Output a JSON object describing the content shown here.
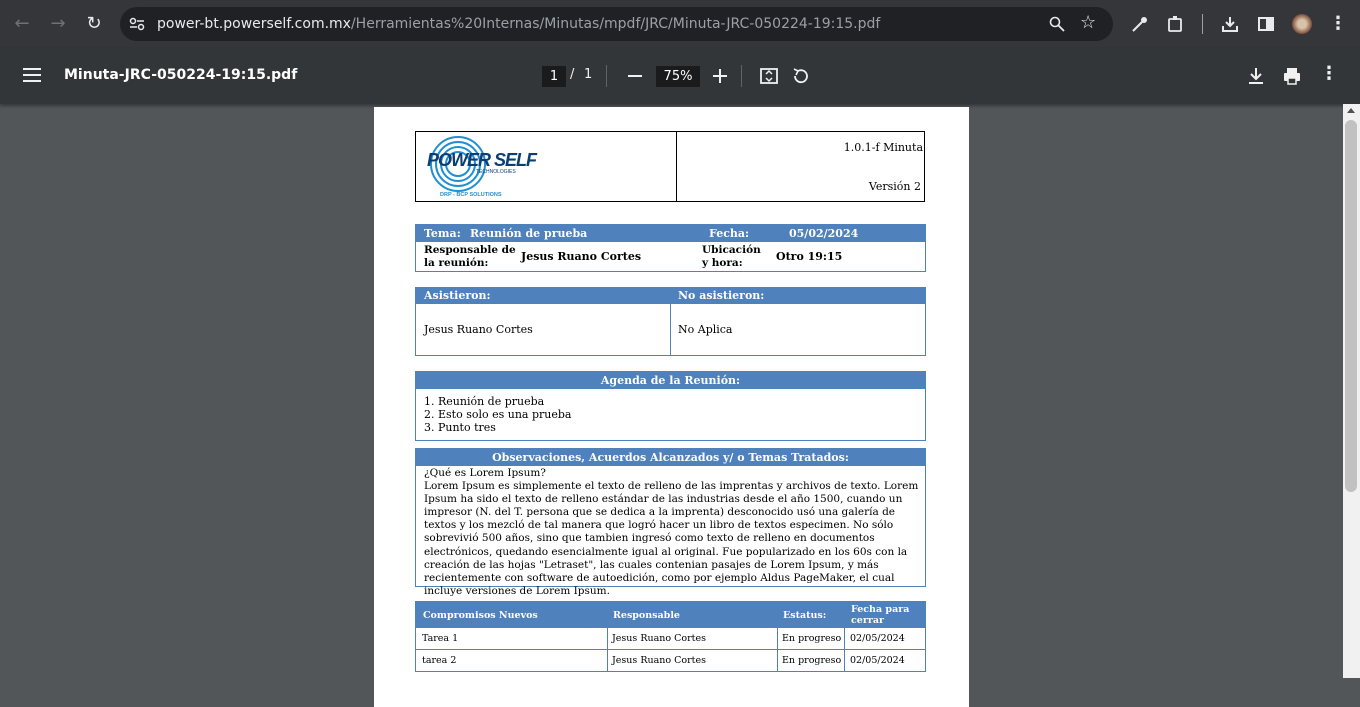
{
  "browser": {
    "url_host": "power-bt.powerself.com.mx",
    "url_path": "/Herramientas%20Internas/Minutas/mpdf/JRC/Minuta-JRC-050224-19:15.pdf"
  },
  "viewer": {
    "filename": "Minuta-JRC-050224-19:15.pdf",
    "page_current": "1",
    "page_sep": "/",
    "page_total": "1",
    "zoom": "75%"
  },
  "doc": {
    "logo": {
      "text": "POWER SELF",
      "sub": "TECHNOLOGIES",
      "tag": "DRP - BCP SOLUTIONS"
    },
    "code": "1.0.1-f Minuta",
    "version": "Versión 2",
    "info": {
      "tema_label": "Tema:",
      "tema": "Reunión de prueba",
      "fecha_label": "Fecha:",
      "fecha": "05/02/2024",
      "resp_label1": "Responsable de",
      "resp_label2": "la reunión:",
      "resp": "Jesus Ruano Cortes",
      "ubic_label1": "Ubicación",
      "ubic_label2": "y hora:",
      "ubic": "Otro 19:15"
    },
    "asist": {
      "h1": "Asistieron:",
      "h2": "No asistieron:",
      "v1": "Jesus Ruano Cortes",
      "v2": "No Aplica"
    },
    "agenda": {
      "title": "Agenda de la Reunión:",
      "items": [
        "1. Reunión de prueba",
        "2. Esto solo es una prueba",
        "3. Punto tres"
      ]
    },
    "obs": {
      "title": "Observaciones, Acuerdos Alcanzados y/ o Temas Tratados:",
      "q": "¿Qué es Lorem Ipsum?",
      "body": "Lorem Ipsum es simplemente el texto de relleno de las imprentas y archivos de texto. Lorem Ipsum ha sido el texto de relleno estándar de las industrias desde el año 1500, cuando un impresor (N. del T. persona que se dedica a la imprenta) desconocido usó una galería de textos y los mezcló de tal manera que logró hacer un libro de textos especimen. No sólo sobrevivió 500 años, sino que tambien ingresó como texto de relleno en documentos electrónicos, quedando esencialmente igual al original. Fue popularizado en los 60s con la creación de las hojas \"Letraset\", las cuales contenian pasajes de Lorem Ipsum, y más recientemente con software de autoedición, como por ejemplo Aldus PageMaker, el cual incluye versiones de Lorem Ipsum."
    },
    "comp": {
      "headers": [
        "Compromisos Nuevos",
        "Responsable",
        "Estatus:",
        "Fecha para cerrar"
      ],
      "rows": [
        [
          "Tarea 1",
          "Jesus Ruano Cortes",
          "En progreso",
          "02/05/2024"
        ],
        [
          "tarea 2",
          "Jesus Ruano Cortes",
          "En progreso",
          "02/05/2024"
        ]
      ]
    }
  }
}
